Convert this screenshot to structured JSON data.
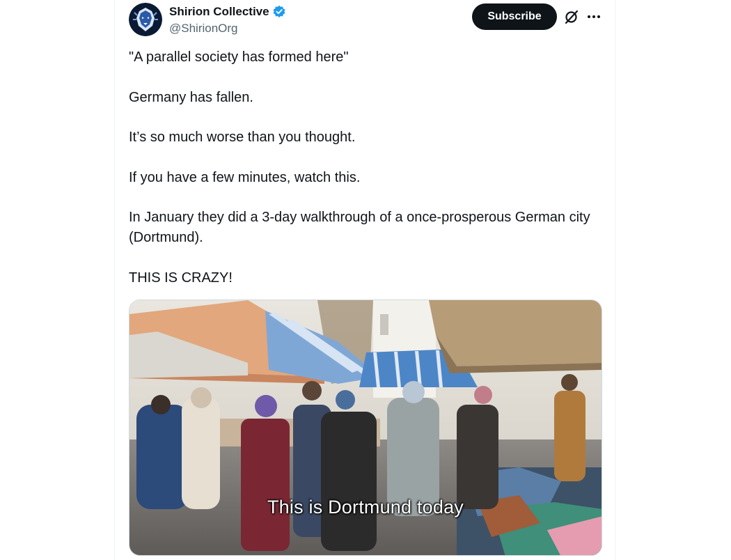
{
  "account": {
    "display_name": "Shirion Collective",
    "handle": "@ShirionOrg",
    "verified": true,
    "verified_color": "#1d9bf0"
  },
  "actions": {
    "subscribe_label": "Subscribe",
    "icons": [
      "grok-icon",
      "more-icon"
    ]
  },
  "tweet": {
    "paragraphs": [
      "\"A parallel society has formed here\"",
      "Germany has fallen.",
      "It’s so much worse than you thought.",
      "If you have a few minutes, watch this.",
      "In January they did a 3-day walkthrough of a once-prosperous German city (Dortmund).",
      "THIS IS CRAZY!"
    ]
  },
  "media": {
    "type": "video",
    "caption": "This is Dortmund today"
  },
  "colors": {
    "text": "#0f1419",
    "secondary_text": "#536471",
    "button_bg": "#0f1419",
    "button_text": "#ffffff"
  }
}
